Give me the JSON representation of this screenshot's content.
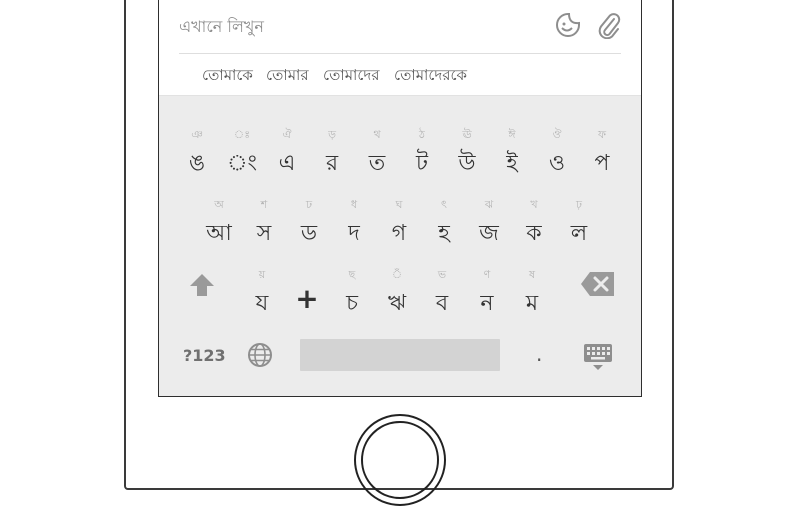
{
  "input": {
    "placeholder": "এখানে লিখুন"
  },
  "suggestions": [
    "তোমাকে",
    "তোমার",
    "তোমাদের",
    "তোমাদেরকে"
  ],
  "keyboard": {
    "row1": [
      {
        "hint": "ঞ",
        "main": "ঙ"
      },
      {
        "hint": "ঃ",
        "main": "ং"
      },
      {
        "hint": "ঐ",
        "main": "এ"
      },
      {
        "hint": "ড়",
        "main": "র"
      },
      {
        "hint": "থ",
        "main": "ত"
      },
      {
        "hint": "ঠ",
        "main": "ট"
      },
      {
        "hint": "ঊ",
        "main": "উ"
      },
      {
        "hint": "ঈ",
        "main": "ই"
      },
      {
        "hint": "ঔ",
        "main": "ও"
      },
      {
        "hint": "ফ",
        "main": "প"
      }
    ],
    "row2": [
      {
        "hint": "অ",
        "main": "আ"
      },
      {
        "hint": "শ",
        "main": "স"
      },
      {
        "hint": "ঢ",
        "main": "ড"
      },
      {
        "hint": "ধ",
        "main": "দ"
      },
      {
        "hint": "ঘ",
        "main": "গ"
      },
      {
        "hint": "ৎ",
        "main": "হ"
      },
      {
        "hint": "ঝ",
        "main": "জ"
      },
      {
        "hint": "খ",
        "main": "ক"
      },
      {
        "hint": "ঢ়",
        "main": "ল"
      }
    ],
    "row3": [
      {
        "hint": "য়",
        "main": "য"
      },
      {
        "hint": "",
        "main": "+"
      },
      {
        "hint": "ছ",
        "main": "চ"
      },
      {
        "hint": "ঁ",
        "main": "ঋ"
      },
      {
        "hint": "ভ",
        "main": "ব"
      },
      {
        "hint": "ণ",
        "main": "ন"
      },
      {
        "hint": "ষ",
        "main": "ম"
      }
    ],
    "symbols_label": "?123",
    "period_label": "."
  },
  "colors": {
    "keyboard_bg": "#ececec",
    "spacebar": "#d3d3d3",
    "icon_gray": "#8e8e8e"
  }
}
